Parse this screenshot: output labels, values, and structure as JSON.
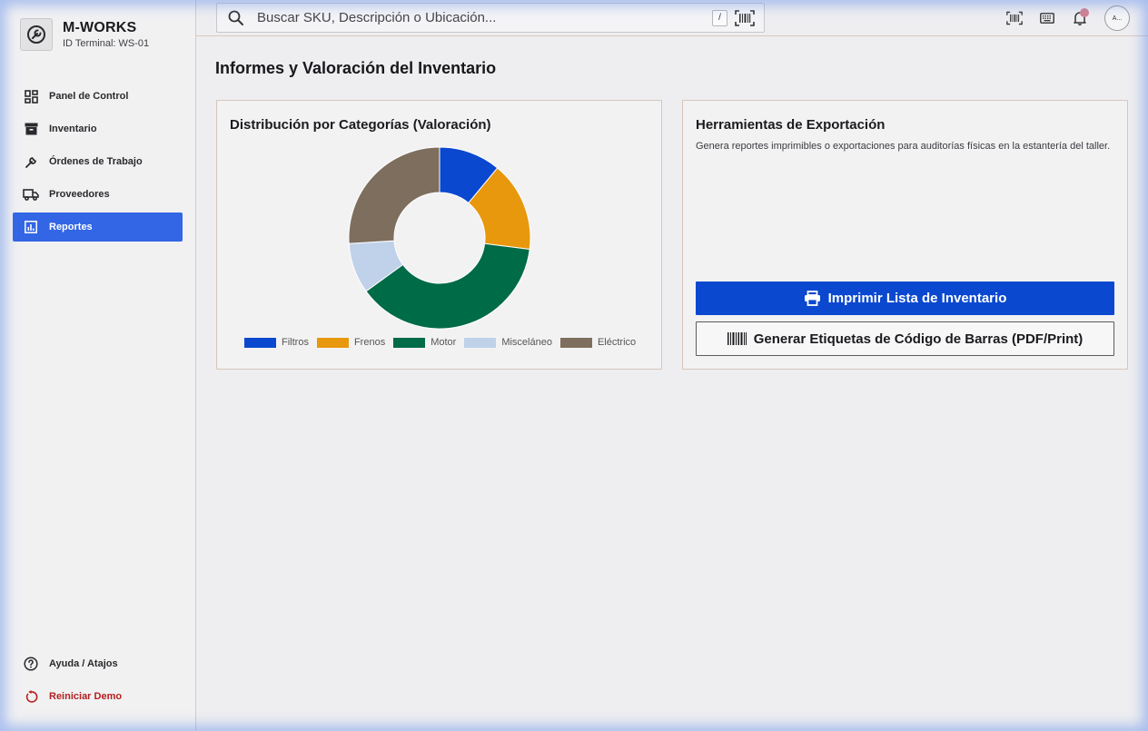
{
  "brand": {
    "title": "M-WORKS",
    "terminal": "ID Terminal: WS-01"
  },
  "sidebar": {
    "items": [
      {
        "label": "Panel de Control",
        "icon": "dashboard-icon",
        "active": false
      },
      {
        "label": "Inventario",
        "icon": "archive-icon",
        "active": false
      },
      {
        "label": "Órdenes de Trabajo",
        "icon": "wrench-icon",
        "active": false
      },
      {
        "label": "Proveedores",
        "icon": "truck-icon",
        "active": false
      },
      {
        "label": "Reportes",
        "icon": "report-icon",
        "active": true
      }
    ],
    "bottom": [
      {
        "label": "Ayuda / Atajos",
        "icon": "help-icon"
      },
      {
        "label": "Reiniciar Demo",
        "icon": "reset-icon"
      }
    ]
  },
  "search": {
    "placeholder": "Buscar SKU, Descripción o Ubicación...",
    "value": "",
    "shortcut": "/"
  },
  "topbar": {
    "icons": [
      "barcode-scan-icon",
      "keyboard-icon",
      "bell-icon"
    ],
    "avatar_text": "A..."
  },
  "page": {
    "title": "Informes y Valoración del Inventario"
  },
  "chart_card": {
    "title": "Distribución por Categorías (Valoración)"
  },
  "chart_data": {
    "type": "pie",
    "donut": true,
    "categories": [
      "Filtros",
      "Frenos",
      "Motor",
      "Misceláneo",
      "Eléctrico"
    ],
    "values": [
      11,
      16,
      38,
      9,
      26
    ],
    "colors": [
      "#0a48cf",
      "#e8980c",
      "#006b47",
      "#c0d1ea",
      "#7e6e5e"
    ],
    "legend_position": "bottom"
  },
  "export_card": {
    "title": "Herramientas de Exportación",
    "description": "Genera reportes imprimibles o exportaciones para auditorías físicas en la estantería del taller.",
    "print_button": "Imprimir Lista de Inventario",
    "barcode_button": "Generar Etiquetas de Código de Barras (PDF/Print)"
  },
  "colors": {
    "accent": "#3366e5",
    "primary_button": "#0a48cf",
    "danger": "#b42020"
  }
}
